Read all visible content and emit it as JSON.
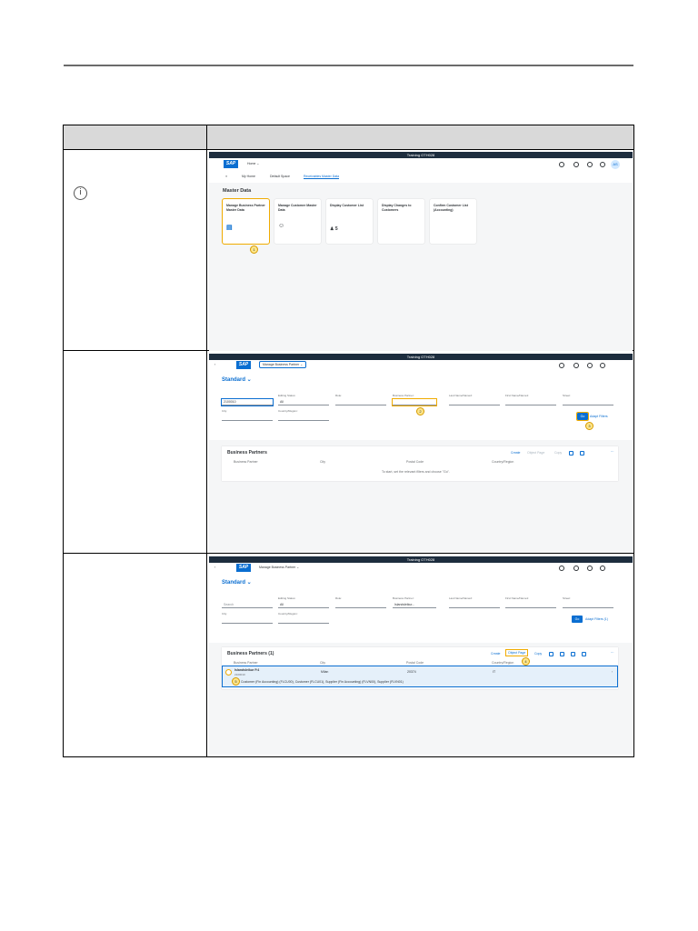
{
  "document": {
    "info_glyph": "i"
  },
  "shot1": {
    "shell_title": "Training  OTH028",
    "logo": "SAP",
    "nav_home": "Home",
    "tabs": [
      "My Home",
      "Default Space",
      "Receivables Master Data"
    ],
    "avatar": "AS",
    "section_title": "Master Data",
    "tiles": [
      {
        "title": "Manage Business Partner Master Data",
        "icon": "card-icon"
      },
      {
        "title": "Manage Customer Master Data",
        "icon": "person-icon"
      },
      {
        "title": "Display Customer List",
        "icon": "people-icon",
        "count": "5"
      },
      {
        "title": "Display Changes to Customers",
        "icon": ""
      },
      {
        "title": "Confirm Customer List (Accounting)",
        "icon": ""
      }
    ],
    "callout": "1"
  },
  "shot2": {
    "shell_title": "Training  OTH028",
    "logo": "SAP",
    "app_title": "Manage Business Partner",
    "variant": "Standard",
    "search_value": "2100010",
    "labels": {
      "editing_status": "Editing Status:",
      "role": "Role:",
      "business_partner": "Business Partner:",
      "last_name": "Last Name/Name2:",
      "first_name": "First Name/Name1:",
      "street": "Street:",
      "city": "City:",
      "country": "Country/Region:"
    },
    "editing_status_value": "All",
    "go": "Go",
    "adapt": "Adapt Filters",
    "callout_bp": "2",
    "callout_go": "3",
    "table_title": "Business Partners",
    "actions": [
      "Create",
      "Object Page",
      "Copy"
    ],
    "columns": [
      "Business Partner",
      "City",
      "Postal Code",
      "Country/Region"
    ],
    "empty_text": "To start, set the relevant filters and choose \"Go\"."
  },
  "shot3": {
    "shell_title": "Training  OTH028",
    "logo": "SAP",
    "app_title": "Manage Business Partner",
    "variant": "Standard",
    "search_placeholder": "Search",
    "labels": {
      "editing_status": "Editing Status:",
      "role": "Role:",
      "business_partner": "Business Partner:",
      "last_name": "Last Name/Name2:",
      "first_name": "First Name/Name1:",
      "street": "Street:",
      "city": "City:",
      "country": "Country/Region:"
    },
    "editing_status_value": "All",
    "bp_value": "Islandsleikur...",
    "go": "Go",
    "adapt": "Adapt Filters (1)",
    "table_title": "Business Partners (1)",
    "actions": [
      "Create",
      "Object Page",
      "Copy"
    ],
    "columns": [
      "Business Partner",
      "City",
      "Postal Code",
      "Country/Region"
    ],
    "row": {
      "name": "Islandsleikur P.4",
      "id": "2100010",
      "city": "Milan",
      "postal": "20374",
      "country": "IT"
    },
    "roles_text": "Customer (Fin Accounting) (FLCU00), Customer (FLCU01), Supplier (Fin Accounting) (FLVN00), Supplier (FLVN01)",
    "callout_op": "4",
    "callout_row": "5"
  }
}
